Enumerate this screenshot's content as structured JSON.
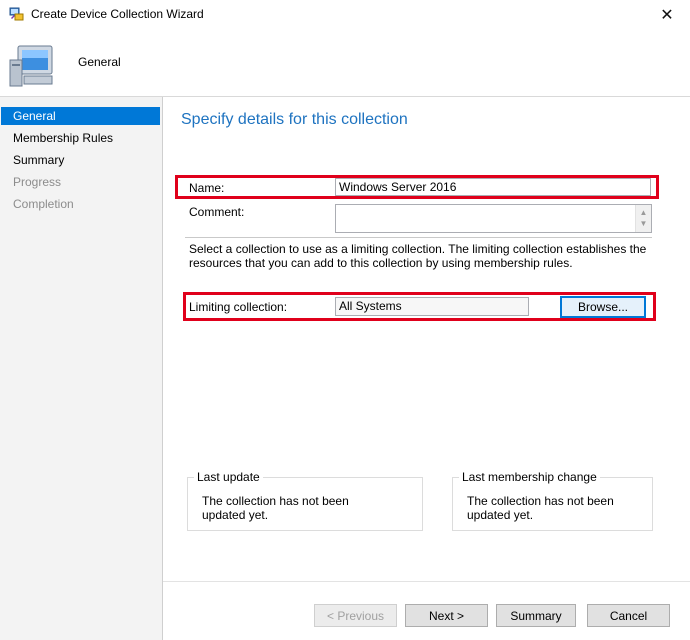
{
  "window": {
    "title": "Create Device Collection Wizard",
    "close_glyph": "✕"
  },
  "header": {
    "title": "General"
  },
  "nav": {
    "items": [
      {
        "label": "General",
        "state": "active"
      },
      {
        "label": "Membership Rules",
        "state": "normal"
      },
      {
        "label": "Summary",
        "state": "normal"
      },
      {
        "label": "Progress",
        "state": "disabled"
      },
      {
        "label": "Completion",
        "state": "disabled"
      }
    ]
  },
  "main": {
    "section_title": "Specify details for this collection",
    "name_label": "Name:",
    "name_value": "Windows Server 2016",
    "comment_label": "Comment:",
    "comment_value": "",
    "description": "Select a collection to use as a limiting collection. The limiting collection establishes the resources that you can add to this collection by using membership rules.",
    "limiting_label": "Limiting collection:",
    "limiting_value": "All Systems",
    "browse_label": "Browse...",
    "last_update": {
      "legend": "Last update",
      "text": "The collection has not been updated yet."
    },
    "last_membership": {
      "legend": "Last membership change",
      "text": "The collection has not been updated yet."
    }
  },
  "footer": {
    "previous_label": "< Previous",
    "next_label": "Next >",
    "summary_label": "Summary",
    "cancel_label": "Cancel"
  },
  "colors": {
    "accent": "#0078d7",
    "title_blue": "#1e73c0",
    "highlight_red": "#e0001b"
  }
}
